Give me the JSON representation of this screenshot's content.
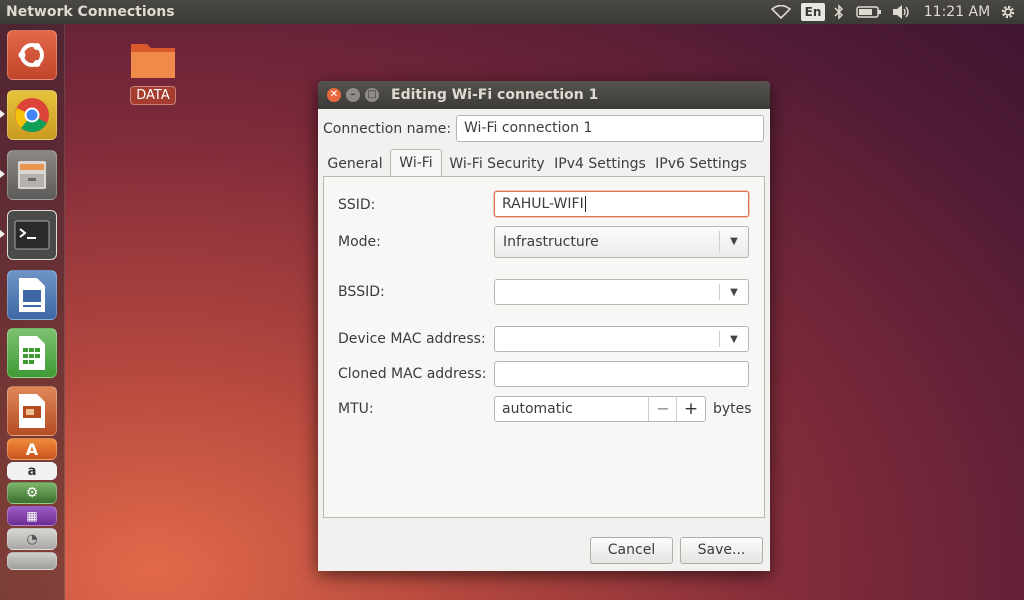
{
  "panel": {
    "app_title": "Network Connections",
    "language": "En",
    "clock": "11:21 AM"
  },
  "launcher": {
    "items": [
      "ubuntu-dash",
      "chrome",
      "file-manager",
      "terminal",
      "libreoffice-writer",
      "libreoffice-calc",
      "libreoffice-impress",
      "ubuntu-software-center",
      "amazon",
      "system-settings",
      "workspace-switcher",
      "trash"
    ]
  },
  "desktop": {
    "folder_label": "DATA"
  },
  "dialog": {
    "title": "Editing Wi-Fi connection 1",
    "connection_name_label": "Connection name:",
    "connection_name_value": "Wi-Fi connection 1",
    "tabs": [
      "General",
      "Wi-Fi",
      "Wi-Fi Security",
      "IPv4 Settings",
      "IPv6 Settings"
    ],
    "active_tab": "Wi-Fi",
    "wifi": {
      "ssid_label": "SSID:",
      "ssid_value": "RAHUL-WIFI",
      "mode_label": "Mode:",
      "mode_value": "Infrastructure",
      "bssid_label": "BSSID:",
      "bssid_value": "",
      "device_mac_label": "Device MAC address:",
      "device_mac_value": "",
      "cloned_mac_label": "Cloned MAC address:",
      "cloned_mac_value": "",
      "mtu_label": "MTU:",
      "mtu_value": "automatic",
      "mtu_unit": "bytes",
      "minus": "−",
      "plus": "+"
    },
    "cancel_label": "Cancel",
    "save_label": "Save..."
  },
  "colors": {
    "accent_focus": "#e0734a",
    "close_button": "#e9693f",
    "panel_bg": "#3b3a36"
  }
}
